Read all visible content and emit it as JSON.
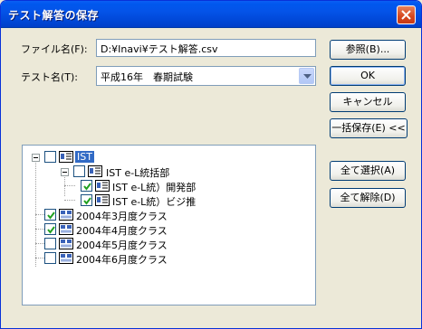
{
  "window": {
    "title": "テスト解答の保存"
  },
  "form": {
    "filename_label": "ファイル名(F):",
    "filename_value": "D:¥Inavi¥テスト解答.csv",
    "testname_label": "テスト名(T):",
    "testname_value": "平成16年　春期試験"
  },
  "buttons": {
    "browse": "参照(B)...",
    "ok": "OK",
    "cancel": "キャンセル",
    "bulk_save": "一括保存(E) <<",
    "select_all": "全て選択(A)",
    "deselect_all": "全て解除(D)"
  },
  "tree": {
    "root": {
      "label": "IST",
      "checked": false,
      "selected": true
    },
    "group": {
      "label": "IST e-L統括部",
      "checked": false
    },
    "group_children": [
      {
        "label": "IST e-L統）開発部",
        "checked": true
      },
      {
        "label": "IST e-L統）ビジ推",
        "checked": true
      }
    ],
    "classes": [
      {
        "label": "2004年3月度クラス",
        "checked": true
      },
      {
        "label": "2004年4月度クラス",
        "checked": true
      },
      {
        "label": "2004年5月度クラス",
        "checked": false
      },
      {
        "label": "2004年6月度クラス",
        "checked": false
      }
    ]
  },
  "icons": {
    "close": "close-icon",
    "dropdown": "chevron-down-icon",
    "org": "org-node-icon",
    "class": "class-node-icon"
  }
}
